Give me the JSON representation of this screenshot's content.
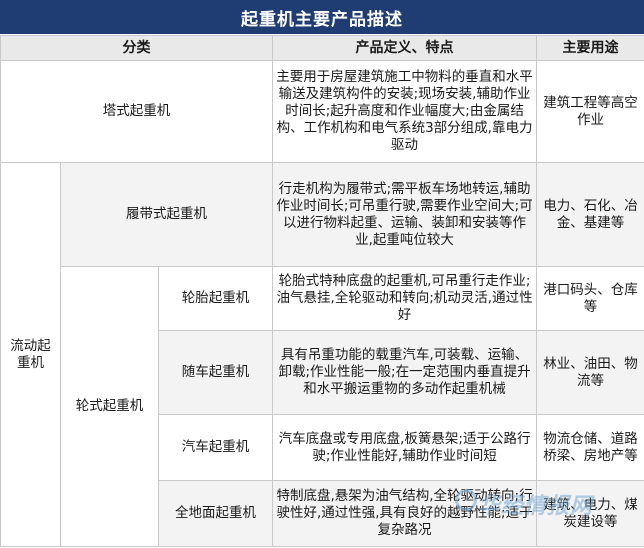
{
  "title": "起重机主要产品描述",
  "headers": {
    "category": "分类",
    "definition": "产品定义、特点",
    "usage": "主要用途"
  },
  "rows": {
    "tower": {
      "name": "塔式起重机",
      "desc": "主要用于房屋建筑施工中物料的垂直和水平输送及建筑构件的安装;现场安装,辅助作业时间长;起升高度和作业幅度大;由金属结构、工作机构和电气系统3部分组成,靠电力驱动",
      "use": "建筑工程等高空作业"
    },
    "mobile_group": "流动起重机",
    "crawler": {
      "name": "履带式起重机",
      "desc": "行走机构为履带式;需平板车场地转运,辅助作业时间长;可吊重行驶,需要作业空间大;可以进行物料起重、运输、装卸和安装等作业,起重吨位较大",
      "use": "电力、石化、冶金、基建等"
    },
    "wheeled_group": "轮式起重机",
    "tire": {
      "name": "轮胎起重机",
      "desc": "轮胎式特种底盘的起重机,可吊重行走作业;油气悬挂,全轮驱动和转向;机动灵活,通过性好",
      "use": "港口码头、仓库等"
    },
    "truck_mounted": {
      "name": "随车起重机",
      "desc": "具有吊重功能的载重汽车,可装载、运输、卸载;作业性能一般;在一定范围内垂直提升和水平搬运重物的多动作起重机械",
      "use": "林业、油田、物流等"
    },
    "truck": {
      "name": "汽车起重机",
      "desc": "汽车底盘或专用底盘,板簧悬架;适于公路行驶;作业性能好,辅助作业时间短",
      "use": "物流仓储、道路桥梁、房地产等"
    },
    "all_terrain": {
      "name": "全地面起重机",
      "desc": "特制底盘,悬架为油气结构,全轮驱动转向;行驶性好,通过性强,具有良好的越野性能;适于复杂路况",
      "use": "建筑、电力、煤炭建设等"
    }
  },
  "watermark": "华经情报网"
}
